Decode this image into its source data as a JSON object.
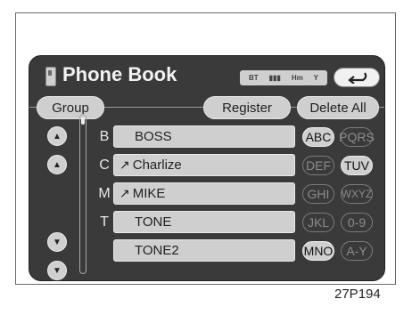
{
  "header": {
    "title": "Phone Book",
    "status_items": [
      "BT",
      "▮▮▮",
      "Hm",
      "Y"
    ]
  },
  "toolbar": {
    "group_label": "Group",
    "register_label": "Register",
    "delete_all_label": "Delete All"
  },
  "entries": [
    {
      "letter": "B",
      "name": "BOSS",
      "icon": ""
    },
    {
      "letter": "C",
      "name": "Charlize",
      "icon": "↗"
    },
    {
      "letter": "M",
      "name": "MIKE",
      "icon": "↗"
    },
    {
      "letter": "T",
      "name": "TONE",
      "icon": ""
    },
    {
      "letter": "",
      "name": "TONE2",
      "icon": ""
    }
  ],
  "keys": [
    {
      "label": "ABC",
      "enabled": true
    },
    {
      "label": "PQRS",
      "enabled": false
    },
    {
      "label": "DEF",
      "enabled": false
    },
    {
      "label": "TUV",
      "enabled": true
    },
    {
      "label": "GHI",
      "enabled": false
    },
    {
      "label": "WXYZ",
      "enabled": false
    },
    {
      "label": "JKL",
      "enabled": false
    },
    {
      "label": "0-9",
      "enabled": false
    },
    {
      "label": "MNO",
      "enabled": true
    },
    {
      "label": "A-Y",
      "enabled": false
    }
  ],
  "caption": "27P194"
}
